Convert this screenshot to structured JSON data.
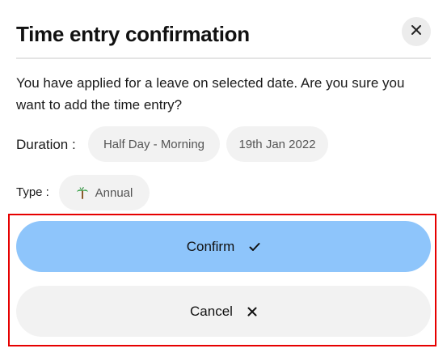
{
  "dialog": {
    "title": "Time entry confirmation",
    "message": "You have applied for a leave on selected date. Are you sure you want to add the time entry?",
    "close_icon": "close-icon"
  },
  "duration": {
    "label": "Duration :",
    "period": "Half Day - Morning",
    "date": "19th Jan 2022"
  },
  "type": {
    "label": "Type :",
    "value": "Annual",
    "icon": "palm-tree-icon"
  },
  "actions": {
    "confirm_label": "Confirm",
    "confirm_icon": "check-icon",
    "cancel_label": "Cancel",
    "cancel_icon": "close-icon"
  },
  "colors": {
    "confirm_bg": "#8ec5fb",
    "secondary_bg": "#f2f2f2",
    "highlight": "#e60000"
  }
}
